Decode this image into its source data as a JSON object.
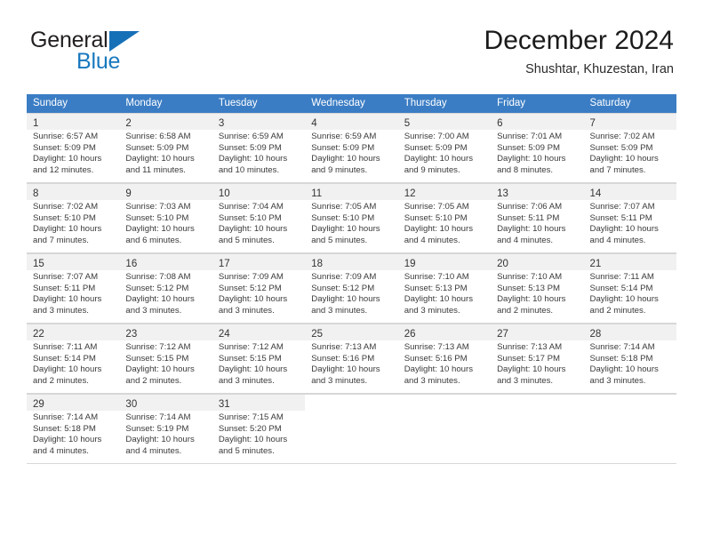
{
  "brand": {
    "name_part1": "General",
    "name_part2": "Blue",
    "accent_color": "#1878be",
    "mark_color": "#1670b8"
  },
  "header": {
    "title": "December 2024",
    "subtitle": "Shushtar, Khuzestan, Iran"
  },
  "calendar": {
    "header_bg": "#3b7dc4",
    "weekdays": [
      "Sunday",
      "Monday",
      "Tuesday",
      "Wednesday",
      "Thursday",
      "Friday",
      "Saturday"
    ],
    "weeks": [
      [
        {
          "day": "1",
          "sunrise": "Sunrise: 6:57 AM",
          "sunset": "Sunset: 5:09 PM",
          "daylight_l1": "Daylight: 10 hours",
          "daylight_l2": "and 12 minutes."
        },
        {
          "day": "2",
          "sunrise": "Sunrise: 6:58 AM",
          "sunset": "Sunset: 5:09 PM",
          "daylight_l1": "Daylight: 10 hours",
          "daylight_l2": "and 11 minutes."
        },
        {
          "day": "3",
          "sunrise": "Sunrise: 6:59 AM",
          "sunset": "Sunset: 5:09 PM",
          "daylight_l1": "Daylight: 10 hours",
          "daylight_l2": "and 10 minutes."
        },
        {
          "day": "4",
          "sunrise": "Sunrise: 6:59 AM",
          "sunset": "Sunset: 5:09 PM",
          "daylight_l1": "Daylight: 10 hours",
          "daylight_l2": "and 9 minutes."
        },
        {
          "day": "5",
          "sunrise": "Sunrise: 7:00 AM",
          "sunset": "Sunset: 5:09 PM",
          "daylight_l1": "Daylight: 10 hours",
          "daylight_l2": "and 9 minutes."
        },
        {
          "day": "6",
          "sunrise": "Sunrise: 7:01 AM",
          "sunset": "Sunset: 5:09 PM",
          "daylight_l1": "Daylight: 10 hours",
          "daylight_l2": "and 8 minutes."
        },
        {
          "day": "7",
          "sunrise": "Sunrise: 7:02 AM",
          "sunset": "Sunset: 5:09 PM",
          "daylight_l1": "Daylight: 10 hours",
          "daylight_l2": "and 7 minutes."
        }
      ],
      [
        {
          "day": "8",
          "sunrise": "Sunrise: 7:02 AM",
          "sunset": "Sunset: 5:10 PM",
          "daylight_l1": "Daylight: 10 hours",
          "daylight_l2": "and 7 minutes."
        },
        {
          "day": "9",
          "sunrise": "Sunrise: 7:03 AM",
          "sunset": "Sunset: 5:10 PM",
          "daylight_l1": "Daylight: 10 hours",
          "daylight_l2": "and 6 minutes."
        },
        {
          "day": "10",
          "sunrise": "Sunrise: 7:04 AM",
          "sunset": "Sunset: 5:10 PM",
          "daylight_l1": "Daylight: 10 hours",
          "daylight_l2": "and 5 minutes."
        },
        {
          "day": "11",
          "sunrise": "Sunrise: 7:05 AM",
          "sunset": "Sunset: 5:10 PM",
          "daylight_l1": "Daylight: 10 hours",
          "daylight_l2": "and 5 minutes."
        },
        {
          "day": "12",
          "sunrise": "Sunrise: 7:05 AM",
          "sunset": "Sunset: 5:10 PM",
          "daylight_l1": "Daylight: 10 hours",
          "daylight_l2": "and 4 minutes."
        },
        {
          "day": "13",
          "sunrise": "Sunrise: 7:06 AM",
          "sunset": "Sunset: 5:11 PM",
          "daylight_l1": "Daylight: 10 hours",
          "daylight_l2": "and 4 minutes."
        },
        {
          "day": "14",
          "sunrise": "Sunrise: 7:07 AM",
          "sunset": "Sunset: 5:11 PM",
          "daylight_l1": "Daylight: 10 hours",
          "daylight_l2": "and 4 minutes."
        }
      ],
      [
        {
          "day": "15",
          "sunrise": "Sunrise: 7:07 AM",
          "sunset": "Sunset: 5:11 PM",
          "daylight_l1": "Daylight: 10 hours",
          "daylight_l2": "and 3 minutes."
        },
        {
          "day": "16",
          "sunrise": "Sunrise: 7:08 AM",
          "sunset": "Sunset: 5:12 PM",
          "daylight_l1": "Daylight: 10 hours",
          "daylight_l2": "and 3 minutes."
        },
        {
          "day": "17",
          "sunrise": "Sunrise: 7:09 AM",
          "sunset": "Sunset: 5:12 PM",
          "daylight_l1": "Daylight: 10 hours",
          "daylight_l2": "and 3 minutes."
        },
        {
          "day": "18",
          "sunrise": "Sunrise: 7:09 AM",
          "sunset": "Sunset: 5:12 PM",
          "daylight_l1": "Daylight: 10 hours",
          "daylight_l2": "and 3 minutes."
        },
        {
          "day": "19",
          "sunrise": "Sunrise: 7:10 AM",
          "sunset": "Sunset: 5:13 PM",
          "daylight_l1": "Daylight: 10 hours",
          "daylight_l2": "and 3 minutes."
        },
        {
          "day": "20",
          "sunrise": "Sunrise: 7:10 AM",
          "sunset": "Sunset: 5:13 PM",
          "daylight_l1": "Daylight: 10 hours",
          "daylight_l2": "and 2 minutes."
        },
        {
          "day": "21",
          "sunrise": "Sunrise: 7:11 AM",
          "sunset": "Sunset: 5:14 PM",
          "daylight_l1": "Daylight: 10 hours",
          "daylight_l2": "and 2 minutes."
        }
      ],
      [
        {
          "day": "22",
          "sunrise": "Sunrise: 7:11 AM",
          "sunset": "Sunset: 5:14 PM",
          "daylight_l1": "Daylight: 10 hours",
          "daylight_l2": "and 2 minutes."
        },
        {
          "day": "23",
          "sunrise": "Sunrise: 7:12 AM",
          "sunset": "Sunset: 5:15 PM",
          "daylight_l1": "Daylight: 10 hours",
          "daylight_l2": "and 2 minutes."
        },
        {
          "day": "24",
          "sunrise": "Sunrise: 7:12 AM",
          "sunset": "Sunset: 5:15 PM",
          "daylight_l1": "Daylight: 10 hours",
          "daylight_l2": "and 3 minutes."
        },
        {
          "day": "25",
          "sunrise": "Sunrise: 7:13 AM",
          "sunset": "Sunset: 5:16 PM",
          "daylight_l1": "Daylight: 10 hours",
          "daylight_l2": "and 3 minutes."
        },
        {
          "day": "26",
          "sunrise": "Sunrise: 7:13 AM",
          "sunset": "Sunset: 5:16 PM",
          "daylight_l1": "Daylight: 10 hours",
          "daylight_l2": "and 3 minutes."
        },
        {
          "day": "27",
          "sunrise": "Sunrise: 7:13 AM",
          "sunset": "Sunset: 5:17 PM",
          "daylight_l1": "Daylight: 10 hours",
          "daylight_l2": "and 3 minutes."
        },
        {
          "day": "28",
          "sunrise": "Sunrise: 7:14 AM",
          "sunset": "Sunset: 5:18 PM",
          "daylight_l1": "Daylight: 10 hours",
          "daylight_l2": "and 3 minutes."
        }
      ],
      [
        {
          "day": "29",
          "sunrise": "Sunrise: 7:14 AM",
          "sunset": "Sunset: 5:18 PM",
          "daylight_l1": "Daylight: 10 hours",
          "daylight_l2": "and 4 minutes."
        },
        {
          "day": "30",
          "sunrise": "Sunrise: 7:14 AM",
          "sunset": "Sunset: 5:19 PM",
          "daylight_l1": "Daylight: 10 hours",
          "daylight_l2": "and 4 minutes."
        },
        {
          "day": "31",
          "sunrise": "Sunrise: 7:15 AM",
          "sunset": "Sunset: 5:20 PM",
          "daylight_l1": "Daylight: 10 hours",
          "daylight_l2": "and 5 minutes."
        },
        null,
        null,
        null,
        null
      ]
    ]
  }
}
